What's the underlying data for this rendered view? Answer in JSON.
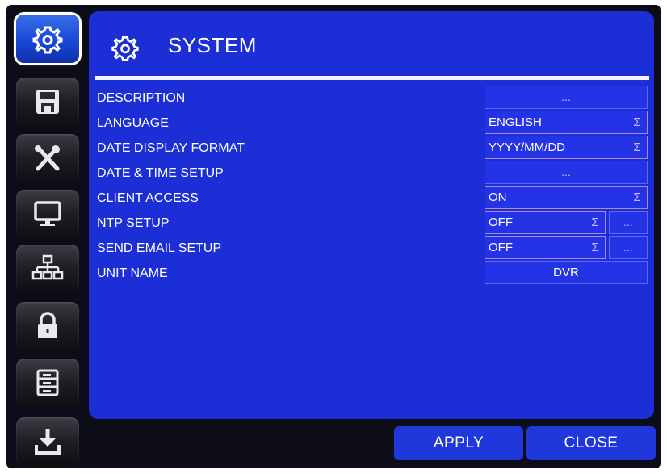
{
  "window": {
    "title": "SYSTEM"
  },
  "sidebar": {
    "items": [
      {
        "icon": "gear-icon",
        "active": true
      },
      {
        "icon": "floppy-disk-icon",
        "active": false
      },
      {
        "icon": "tools-icon",
        "active": false
      },
      {
        "icon": "monitor-icon",
        "active": false
      },
      {
        "icon": "network-icon",
        "active": false
      },
      {
        "icon": "lock-icon",
        "active": false
      },
      {
        "icon": "storage-icon",
        "active": false
      },
      {
        "icon": "download-icon",
        "active": false
      }
    ]
  },
  "settings": {
    "description": {
      "label": "DESCRIPTION",
      "value": "..."
    },
    "language": {
      "label": "LANGUAGE",
      "value": "ENGLISH"
    },
    "date_display_format": {
      "label": "DATE DISPLAY FORMAT",
      "value": "YYYY/MM/DD"
    },
    "date_time_setup": {
      "label": "DATE & TIME SETUP",
      "value": "..."
    },
    "client_access": {
      "label": "CLIENT ACCESS",
      "value": "ON"
    },
    "ntp_setup": {
      "label": "NTP SETUP",
      "value": "OFF",
      "button": "..."
    },
    "send_email_setup": {
      "label": "SEND EMAIL SETUP",
      "value": "OFF",
      "button": "..."
    },
    "unit_name": {
      "label": "UNIT NAME",
      "value": "DVR"
    }
  },
  "footer": {
    "apply_label": "APPLY",
    "close_label": "CLOSE"
  },
  "colors": {
    "panel": "#1c2fd6",
    "field": "#2433e6",
    "frame": "#0d0d1a",
    "active_button": "#1a48d8"
  }
}
